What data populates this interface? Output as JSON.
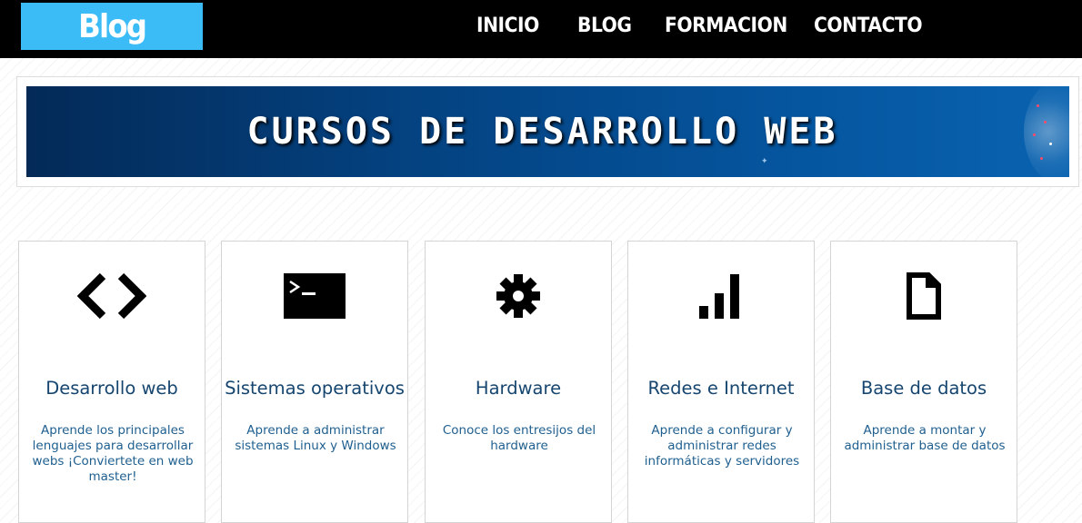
{
  "header": {
    "logo_text": "Blog",
    "nav": [
      "INICIO",
      "BLOG",
      "FORMACION",
      "CONTACTO"
    ],
    "colors": {
      "bar": "#000000",
      "logo_bg": "#3bbcf7"
    }
  },
  "hero": {
    "title": "CURSOS DE DESARROLLO WEB",
    "colors": {
      "from": "#032a57",
      "to": "#0a63b0"
    }
  },
  "cards": [
    {
      "icon": "code-icon",
      "title": "Desarrollo web",
      "text": "Aprende los principales lenguajes para desarrollar webs ¡Conviertete en web master!"
    },
    {
      "icon": "terminal-icon",
      "title": "Sistemas operativos",
      "text": "Aprende a administrar sistemas Linux y Windows"
    },
    {
      "icon": "gear-icon",
      "title": "Hardware",
      "text": "Conoce los entresijos del hardware"
    },
    {
      "icon": "signal-bars-icon",
      "title": "Redes e Internet",
      "text": "Aprende a configurar y administrar redes informáticas y servidores"
    },
    {
      "icon": "document-icon",
      "title": "Base de datos",
      "text": "Aprende a montar y administrar base de datos"
    }
  ],
  "colors": {
    "card_title": "#16466f",
    "card_text": "#1f5f8f"
  }
}
